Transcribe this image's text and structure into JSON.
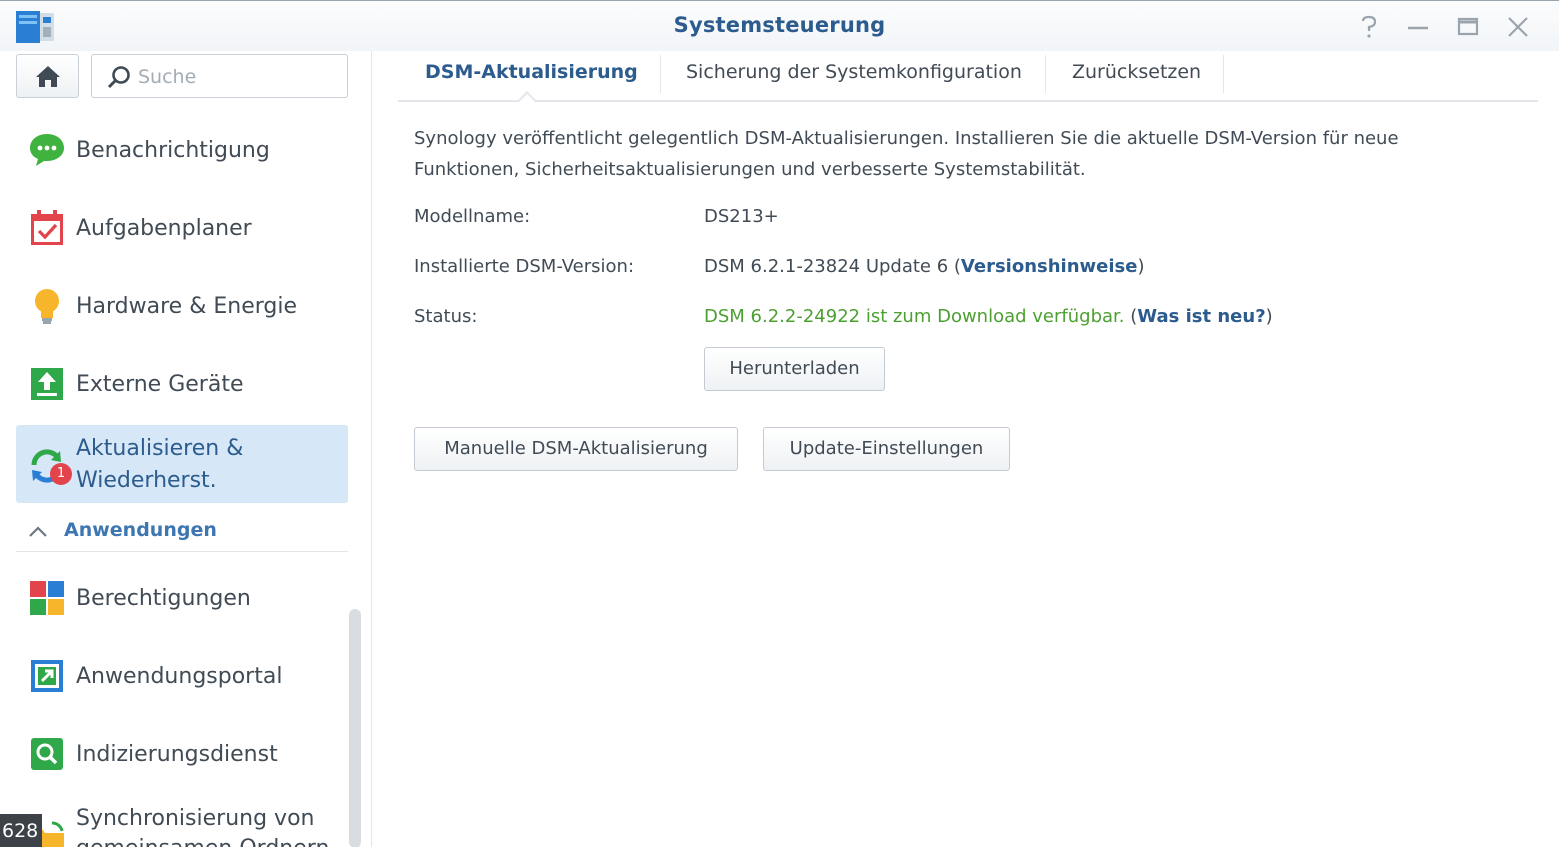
{
  "window": {
    "title": "Systemsteuerung",
    "controls": [
      "help-icon",
      "minimize-icon",
      "maximize-icon",
      "close-icon"
    ]
  },
  "sidebar": {
    "home_icon": "home-icon",
    "search": {
      "placeholder": "Suche",
      "value": ""
    },
    "items": [
      {
        "label": "Benachrichtigung",
        "icon": "notification-icon"
      },
      {
        "label": "Aufgabenplaner",
        "icon": "task-scheduler-icon"
      },
      {
        "label": "Hardware & Energie",
        "icon": "hardware-power-icon"
      },
      {
        "label": "Externe Geräte",
        "icon": "external-devices-icon"
      },
      {
        "label_line1": "Aktualisieren &",
        "label_line2": "Wiederherst.",
        "icon": "update-restore-icon",
        "badge": "1",
        "active": true
      }
    ],
    "section": {
      "label": "Anwendungen",
      "expanded": true
    },
    "app_items": [
      {
        "label": "Berechtigungen",
        "icon": "privileges-icon"
      },
      {
        "label": "Anwendungsportal",
        "icon": "application-portal-icon"
      },
      {
        "label": "Indizierungsdienst",
        "icon": "indexing-service-icon"
      },
      {
        "label_line1": "Synchronisierung von",
        "label_line2": "gemeinsamen Ordnern",
        "icon": "shared-folder-sync-icon"
      }
    ],
    "corner_badge": "628"
  },
  "tabs": [
    {
      "label": "DSM-Aktualisierung",
      "active": true
    },
    {
      "label": "Sicherung der Systemkonfiguration",
      "active": false
    },
    {
      "label": "Zurücksetzen",
      "active": false
    }
  ],
  "content": {
    "description_line1": "Synology veröffentlicht gelegentlich DSM-Aktualisierungen. Installieren Sie die aktuelle DSM-Version für neue",
    "description_line2": "Funktionen, Sicherheitsaktualisierungen und verbesserte Systemstabilität.",
    "model": {
      "label": "Modellname:",
      "value": "DS213+"
    },
    "installed": {
      "label": "Installierte DSM-Version:",
      "value": "DSM 6.2.1-23824 Update 6 (",
      "link": "Versionshinweise",
      "suffix": ")"
    },
    "status": {
      "label": "Status:",
      "value": "DSM 6.2.2-24922 ist zum Download verfügbar.",
      "prefix2": " (",
      "link": "Was ist neu?",
      "suffix": ")",
      "color": "#4ca032"
    },
    "download_button": "Herunterladen",
    "manual_update_button": "Manuelle DSM-Aktualisierung",
    "update_settings_button": "Update-Einstellungen"
  },
  "colors": {
    "accent": "#2c5b8d",
    "link": "#2c5b8d",
    "active_bg": "#d6e7f7",
    "status_ok": "#4ca032"
  }
}
